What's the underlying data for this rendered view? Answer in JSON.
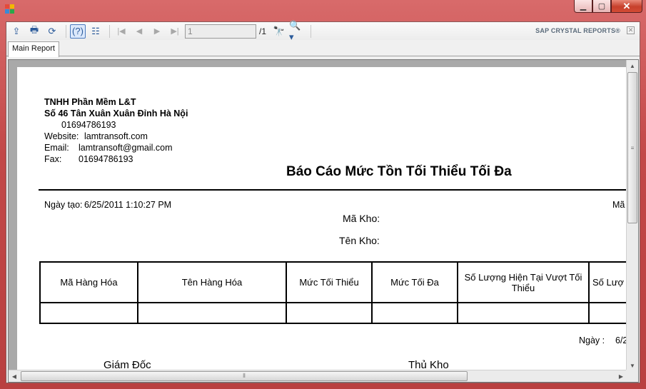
{
  "toolbar": {
    "page_input_value": "1",
    "page_total": "/1",
    "brand": "SAP CRYSTAL REPORTS®",
    "icons": [
      "export-icon",
      "print-icon",
      "refresh-icon",
      "help-icon",
      "group-tree-icon",
      "first-page-icon",
      "previous-page-icon",
      "next-page-icon",
      "last-page-icon",
      "find-icon",
      "zoom-icon"
    ]
  },
  "tabs": [
    {
      "label": "Main Report"
    }
  ],
  "report": {
    "company": "TNHH Phần Mềm L&T",
    "address": "Số 46 Tân Xuân Xuân Đỉnh Hà Nội",
    "phone": "01694786193",
    "website_label": "Website:",
    "website": "lamtransoft.com",
    "email_label": "Email:",
    "email": "lamtransoft@gmail.com",
    "fax_label": "Fax:",
    "fax": "01694786193",
    "title": "Báo Cáo Mức Tồn Tối Thiểu Tối Đa",
    "created_label": "Ngày tạo:",
    "created_value": "6/25/2011 1:10:27 PM",
    "right_cut": "Mã",
    "warehouse_code_label": "Mã Kho:",
    "warehouse_name_label": "Tên Kho:",
    "columns": [
      "Mã Hàng Hóa",
      "Tên Hàng Hóa",
      "Mức Tối Thiểu",
      "Mức Tối Đa",
      "Số Lượng Hiện Tại Vượt Tối Thiểu",
      "Số Lượ"
    ],
    "date_label": "Ngày :",
    "date_value_cut": "6/2",
    "director_label": "Giám Đốc",
    "storekeeper_label": "Thủ Kho"
  },
  "colors": {
    "frame": "#c24848",
    "close_button": "#c6402c",
    "viewer_bg": "#a9a9a9",
    "accent": "#2a5a9a"
  }
}
